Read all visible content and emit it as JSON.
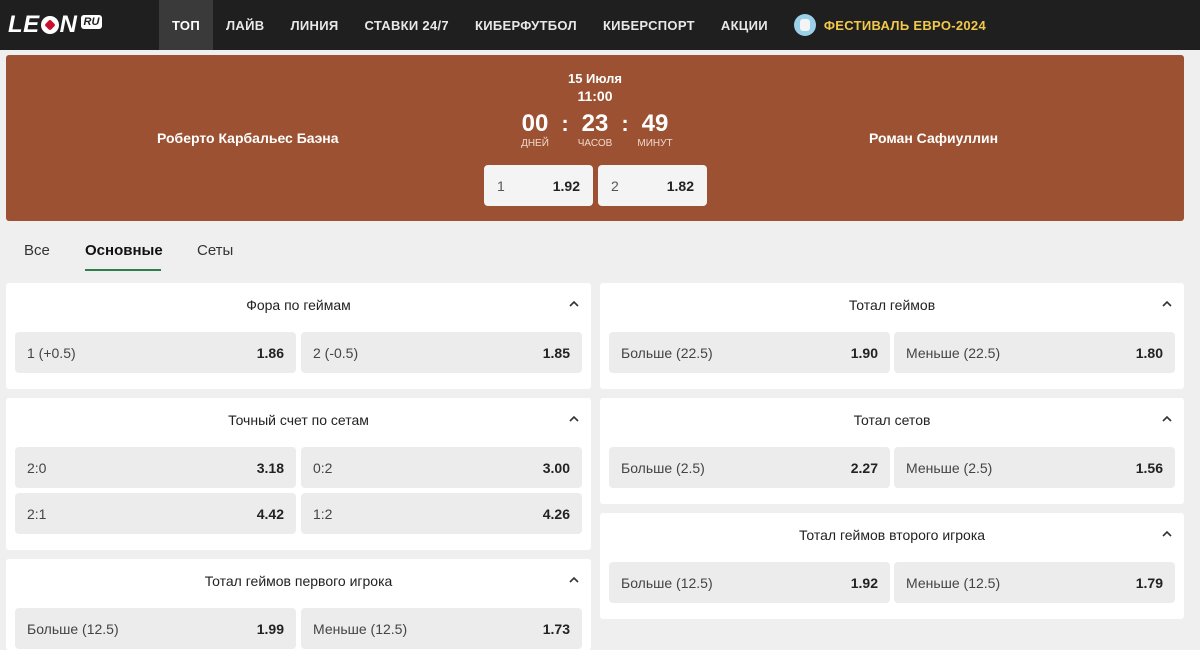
{
  "nav": {
    "logo_pre": "LE",
    "logo_post": "N",
    "logo_ru": "RU",
    "items": [
      "ТОП",
      "ЛАЙВ",
      "ЛИНИЯ",
      "СТАВКИ 24/7",
      "КИБЕРФУТБОЛ",
      "КИБЕРСПОРТ",
      "АКЦИИ"
    ],
    "promo": "ФЕСТИВАЛЬ ЕВРО-2024"
  },
  "event": {
    "date": "15 Июля",
    "time": "11:00",
    "team_left": "Роберто Карбальес Баэна",
    "team_right": "Роман Сафиуллин",
    "countdown": {
      "days": "00",
      "days_label": "ДНЕЙ",
      "hours": "23",
      "hours_label": "ЧАСОВ",
      "minutes": "49",
      "minutes_label": "МИНУТ"
    },
    "odds": [
      {
        "label": "1",
        "value": "1.92"
      },
      {
        "label": "2",
        "value": "1.82"
      }
    ]
  },
  "tabs": [
    "Все",
    "Основные",
    "Сеты"
  ],
  "markets": {
    "handicap": {
      "title": "Фора по геймам",
      "cells": [
        {
          "label": "1 (+0.5)",
          "value": "1.86"
        },
        {
          "label": "2 (-0.5)",
          "value": "1.85"
        }
      ]
    },
    "exact_score": {
      "title": "Точный счет по сетам",
      "cells": [
        {
          "label": "2:0",
          "value": "3.18"
        },
        {
          "label": "0:2",
          "value": "3.00"
        },
        {
          "label": "2:1",
          "value": "4.42"
        },
        {
          "label": "1:2",
          "value": "4.26"
        }
      ]
    },
    "total_first": {
      "title": "Тотал геймов первого игрока",
      "cells": [
        {
          "label": "Больше (12.5)",
          "value": "1.99"
        },
        {
          "label": "Меньше (12.5)",
          "value": "1.73"
        }
      ]
    },
    "total_games": {
      "title": "Тотал геймов",
      "cells": [
        {
          "label": "Больше (22.5)",
          "value": "1.90"
        },
        {
          "label": "Меньше (22.5)",
          "value": "1.80"
        }
      ]
    },
    "total_sets": {
      "title": "Тотал сетов",
      "cells": [
        {
          "label": "Больше (2.5)",
          "value": "2.27"
        },
        {
          "label": "Меньше (2.5)",
          "value": "1.56"
        }
      ]
    },
    "total_second": {
      "title": "Тотал геймов второго игрока",
      "cells": [
        {
          "label": "Больше (12.5)",
          "value": "1.92"
        },
        {
          "label": "Меньше (12.5)",
          "value": "1.79"
        }
      ]
    }
  },
  "colors": {
    "nav_bg": "#1f1f1f",
    "event_bg": "#9c5232",
    "promo": "#f2c84b",
    "tab_accent": "#2e7d4a"
  }
}
